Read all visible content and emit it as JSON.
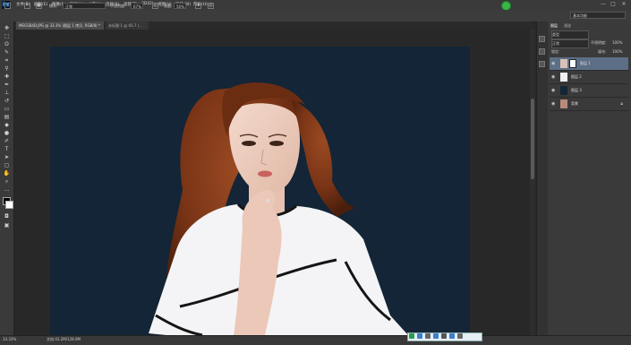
{
  "menubar": {
    "app_icon": "Ps",
    "items": [
      "文件(F)",
      "编辑(E)",
      "图像(I)",
      "图层(L)",
      "文字(Y)",
      "选择(S)",
      "滤镜(T)",
      "3D(D)",
      "视图(V)",
      "窗口(W)",
      "帮助(H)"
    ],
    "window_buttons": [
      "—",
      "□",
      "✕"
    ]
  },
  "options": {
    "mode_label": "模式:",
    "mode_value": "正常",
    "opacity_label": "不透明度:",
    "opacity_value": "67%",
    "flow_label": "流量:",
    "flow_value": "56%",
    "preset": "基本功能"
  },
  "tabs": [
    {
      "label": "MEGSB4D.JPG @ 33.3% (图层 1 拷贝, RGB/8) *",
      "active": true
    },
    {
      "label": "未标题-1 @ 66.7 (...",
      "active": false
    }
  ],
  "layers_panel": {
    "tabs": [
      "图层",
      "通道"
    ],
    "filter_label": "类型",
    "blend_mode": "正常",
    "opacity_label": "不透明度:",
    "opacity_value": "100%",
    "lock_label": "锁定:",
    "fill_label": "填充:",
    "fill_value": "100%",
    "layers": [
      {
        "name": "图层 1",
        "selected": true,
        "thumb_color": "#d9c1b5",
        "has_mask": true
      },
      {
        "name": "图层 2",
        "selected": false,
        "thumb_color": "#f0f0f0",
        "has_mask": false
      },
      {
        "name": "图层 3",
        "selected": false,
        "thumb_color": "#132536",
        "has_mask": false
      },
      {
        "name": "背景",
        "selected": false,
        "thumb_color": "#b88a7c",
        "has_mask": false,
        "locked": true
      }
    ]
  },
  "status": {
    "zoom": "33.33%",
    "doc_info": "文档:43.2M/128.0M"
  },
  "colors": {
    "canvas_bg": "#132536",
    "accent": "#3bb54a"
  }
}
